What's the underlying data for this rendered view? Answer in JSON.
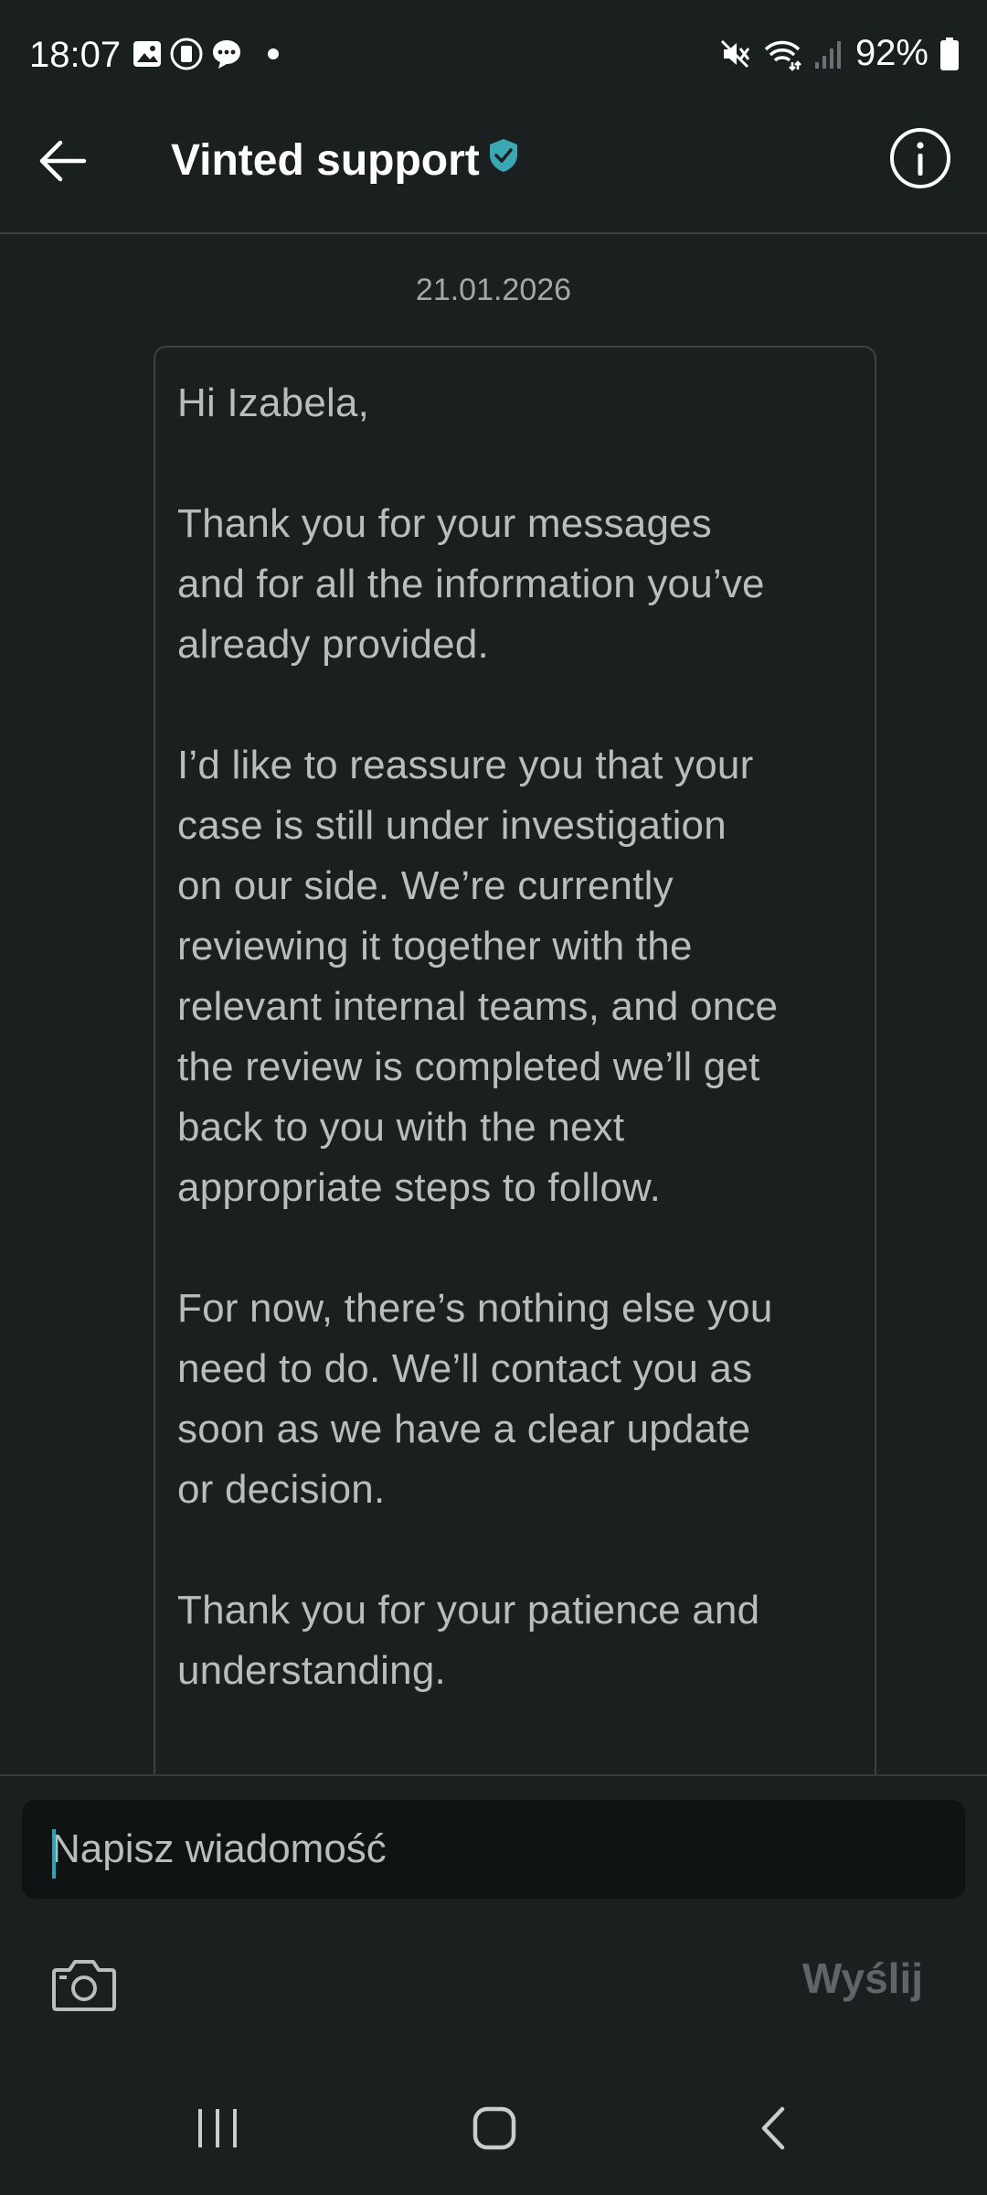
{
  "status_bar": {
    "time": "18:07",
    "notification_icons": [
      "gallery-icon",
      "sim-icon",
      "chat-bubble-icon",
      "dot-icon"
    ],
    "system_icons": [
      "mute-icon",
      "wifi-icon",
      "signal-icon"
    ],
    "battery_percent": "92%"
  },
  "header": {
    "title": "Vinted support",
    "verified": true,
    "accent_color": "#3ba7b3"
  },
  "conversation": {
    "date": "21.01.2026",
    "message": "Hi Izabela,\n\nThank you for your messages\nand for all the information you’ve\nalready provided.\n\nI’d like to reassure you that your\ncase is still under investigation\non our side. We’re currently\nreviewing it together with the\nrelevant internal teams, and once\nthe review is completed we’ll get\nback to you with the next\nappropriate steps to follow.\n\nFor now, there’s nothing else you\nneed to do. We’ll contact you as\nsoon as we have a clear update\nor decision.\n\nThank you for your patience and\nunderstanding.\n\nBest regards,"
  },
  "composer": {
    "placeholder": "Napisz wiadomość",
    "value": "",
    "send_label": "Wyślij",
    "camera_icon": "camera-icon"
  },
  "nav_bar": {
    "icons": [
      "recent-apps-icon",
      "home-icon",
      "back-icon"
    ]
  }
}
